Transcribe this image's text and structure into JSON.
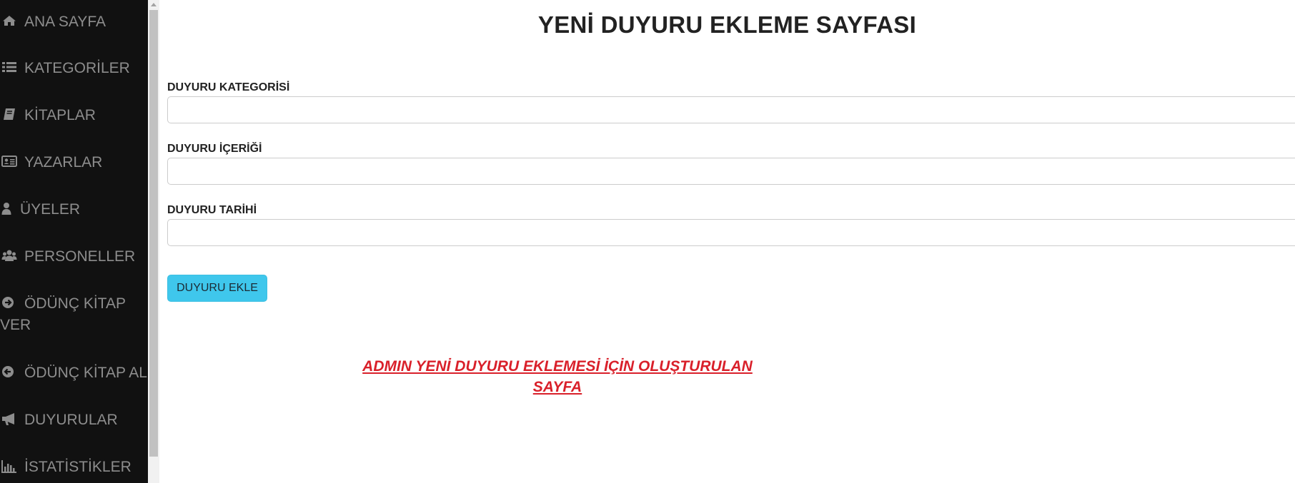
{
  "sidebar": {
    "items": [
      {
        "label": "ANA SAYFA",
        "icon": "home-icon"
      },
      {
        "label": "KATEGORİLER",
        "icon": "list-icon"
      },
      {
        "label": "KİTAPLAR",
        "icon": "book-icon"
      },
      {
        "label": "YAZARLAR",
        "icon": "id-card-icon"
      },
      {
        "label": "ÜYELER",
        "icon": "user-icon"
      },
      {
        "label": "PERSONELLER",
        "icon": "users-icon"
      },
      {
        "label": "ÖDÜNÇ KİTAP VER",
        "icon": "arrow-circle-right-icon"
      },
      {
        "label": "ÖDÜNÇ KİTAP AL",
        "icon": "arrow-circle-left-icon"
      },
      {
        "label": "DUYURULAR",
        "icon": "bullhorn-icon"
      },
      {
        "label": "İSTATİSTİKLER",
        "icon": "bar-chart-icon"
      }
    ]
  },
  "main": {
    "title": "YENİ DUYURU EKLEME SAYFASI",
    "form": {
      "category_label": "DUYURU KATEGORİSİ",
      "category_value": "",
      "content_label": "DUYURU İÇERİĞİ",
      "content_value": "",
      "date_label": "DUYURU TARİHİ",
      "date_value": "",
      "submit_label": "DUYURU EKLE"
    },
    "note": "ADMIN YENİ DUYURU EKLEMESİ İÇİN OLUŞTURULAN SAYFA"
  },
  "colors": {
    "sidebar_bg": "#111111",
    "sidebar_text": "#8d8d8d",
    "button_bg": "#3fc7ec",
    "note_text": "#d9202a"
  }
}
